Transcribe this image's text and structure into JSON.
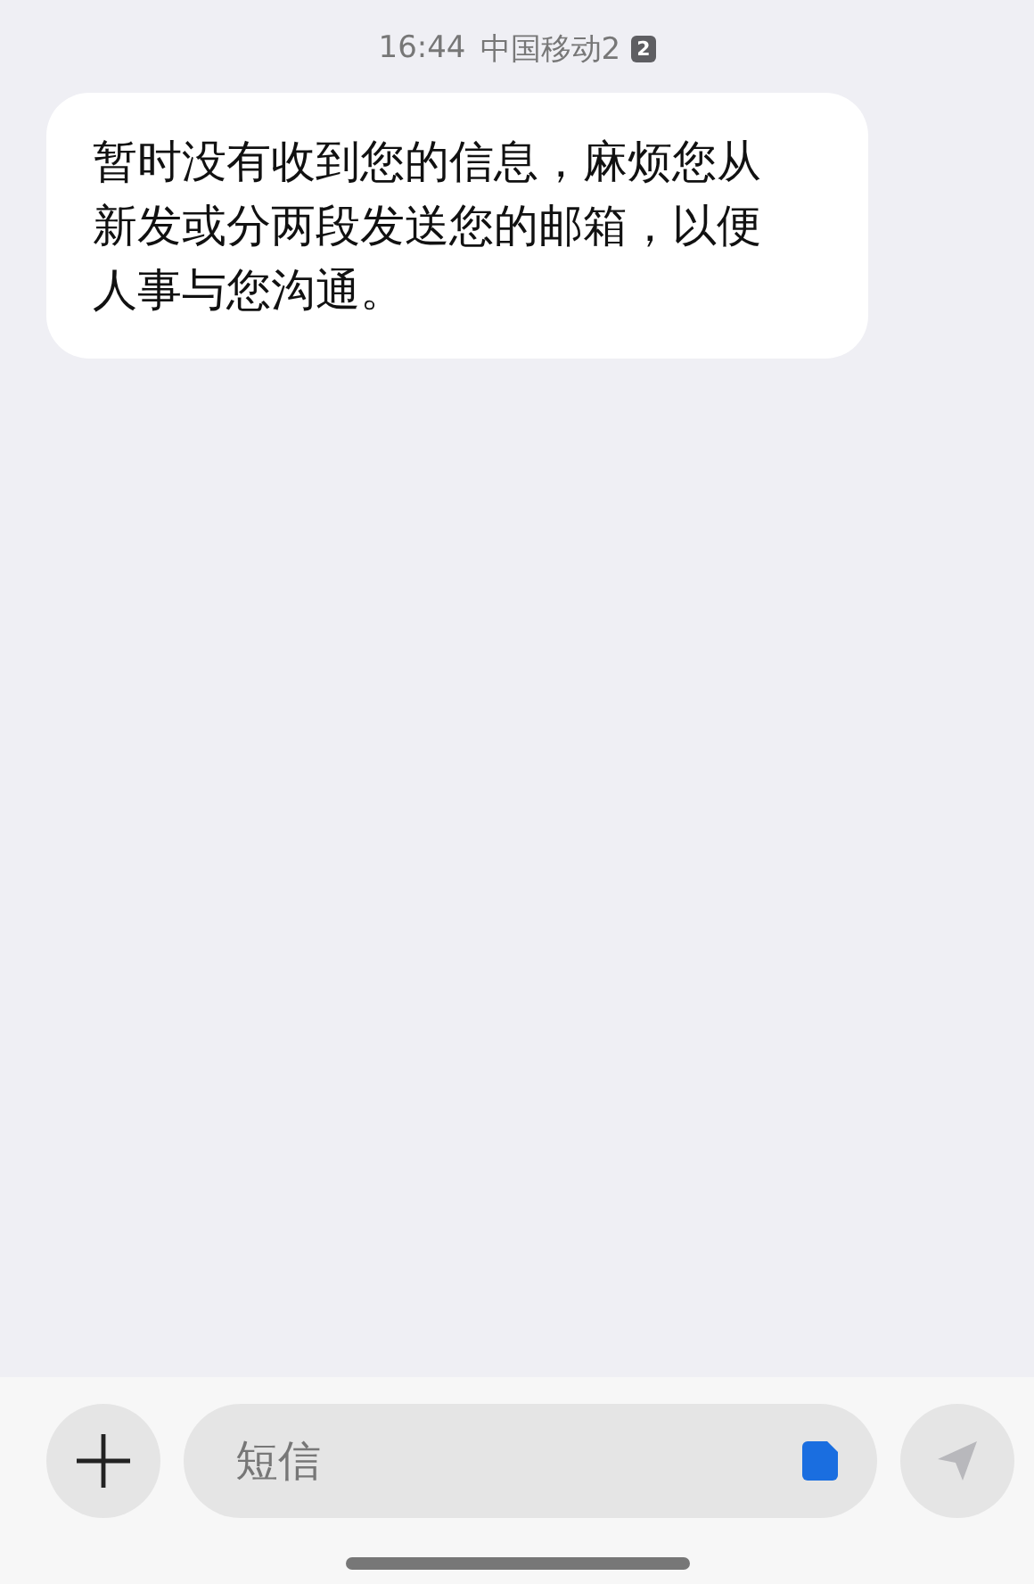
{
  "header": {
    "time": "16:44",
    "carrier": "中国移动2",
    "sim_badge": "2"
  },
  "messages": [
    {
      "text": "暂时没有收到您的信息，麻烦您从新发或分两段发送您的邮箱，以便人事与您沟通。"
    }
  ],
  "composer": {
    "placeholder": "短信"
  }
}
